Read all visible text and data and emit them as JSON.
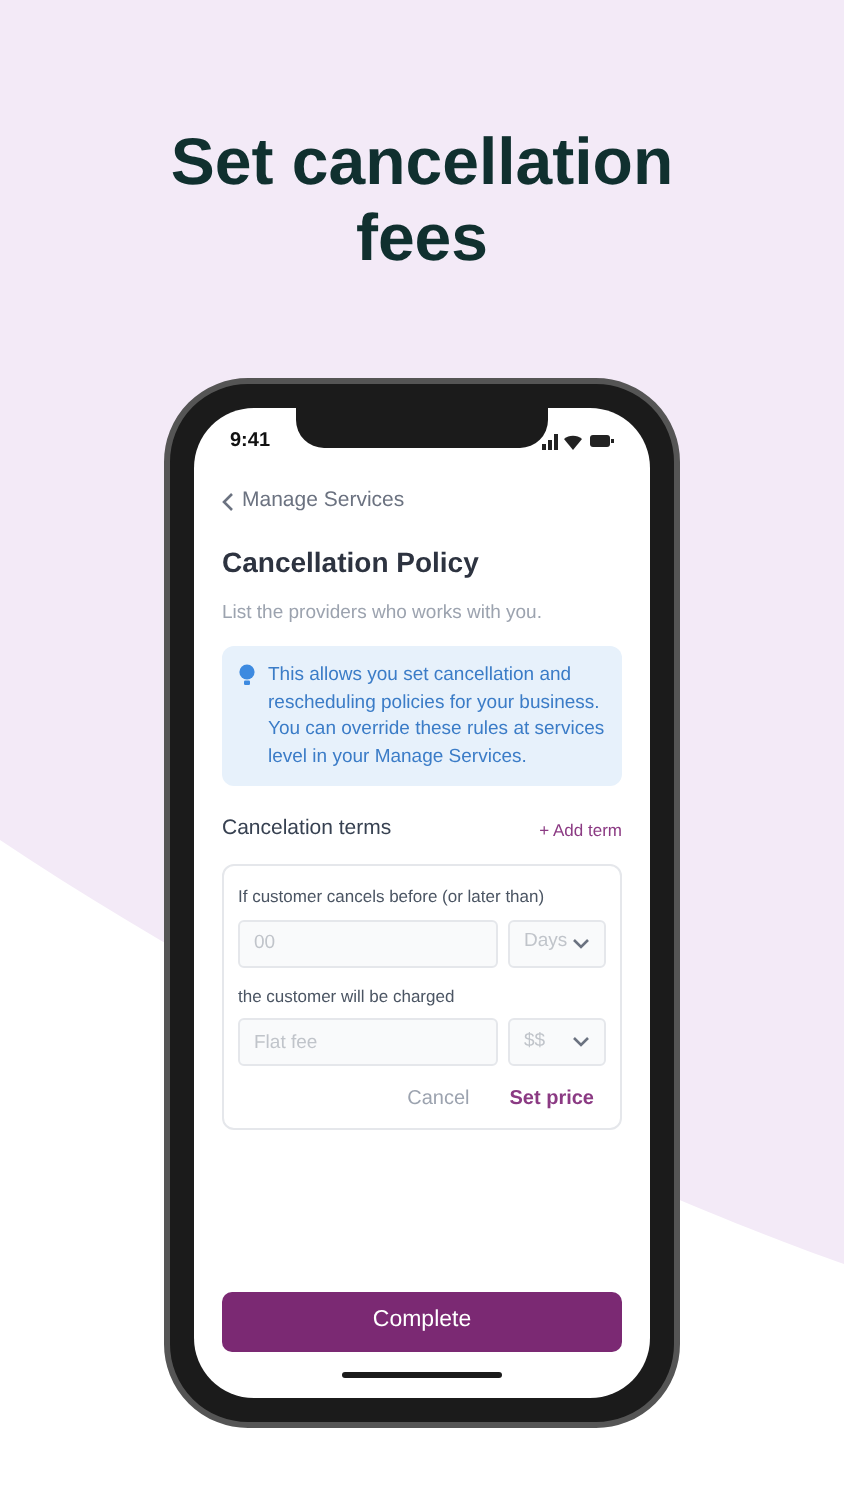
{
  "headline": "Set cancellation fees",
  "status_bar": {
    "time": "9:41"
  },
  "back_link": "Manage Services",
  "title": "Cancellation Policy",
  "subtitle": "List the providers who works with you.",
  "info_text": "This allows you set cancellation and rescheduling policies for your business. You can override these rules at services level in your Manage Services.",
  "terms": {
    "label": "Cancelation terms",
    "add_button": "+ Add term"
  },
  "form": {
    "rows": [
      {
        "label": "If customer cancels before (or later than)",
        "input": {
          "placeholder": "00"
        },
        "select": {
          "value": "Days"
        }
      },
      {
        "label": "the customer will be charged",
        "input": {
          "placeholder": "Flat fee"
        },
        "select": {
          "value": "$$"
        }
      }
    ],
    "actions": [
      {
        "label": "Cancel",
        "kind": "secondary"
      },
      {
        "label": "Set price",
        "kind": "primary"
      }
    ]
  },
  "complete_button": "Complete"
}
